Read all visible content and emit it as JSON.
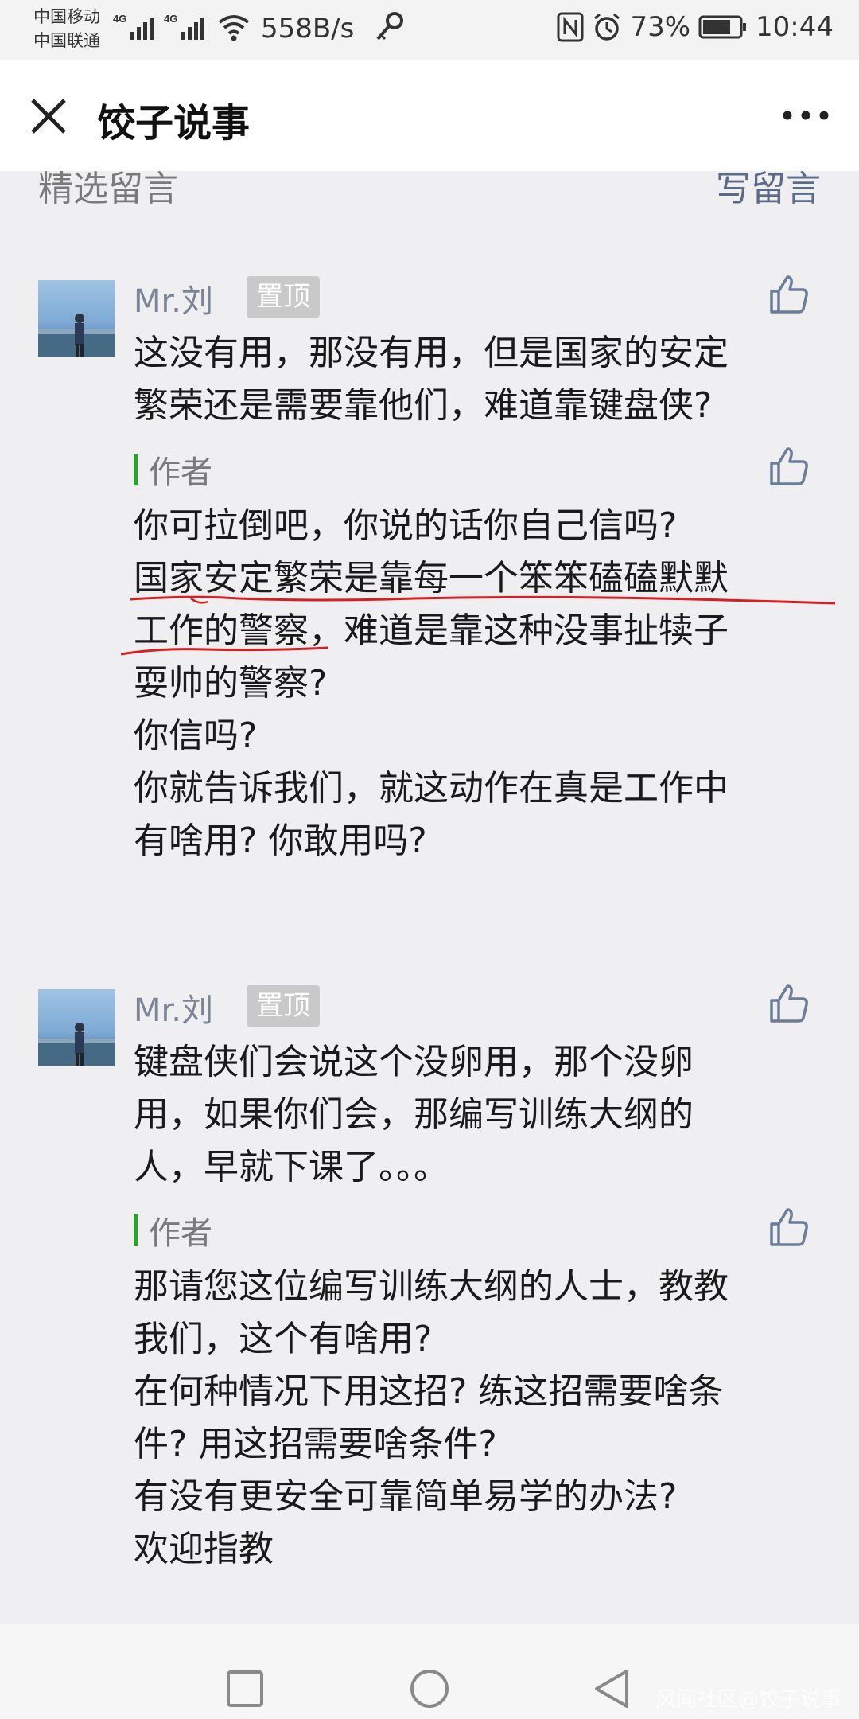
{
  "status_bar": {
    "carrier_1": "中国移动",
    "carrier_2": "中国联通",
    "net_speed": "558B/s",
    "battery": "73%",
    "time": "10:44"
  },
  "header": {
    "title": "饺子说事"
  },
  "section": {
    "title": "精选留言",
    "write_comment": "写留言"
  },
  "comments": [
    {
      "nickname": "Mr.刘",
      "badge": "置顶",
      "lines": [
        "这没有用，那没有用，但是国家的安定",
        "繁荣还是需要靠他们，难道靠键盘侠?"
      ],
      "reply": {
        "label": "作者",
        "lines": [
          "你可拉倒吧，你说的话你自己信吗?",
          "国家安定繁荣是靠每一个笨笨磕磕默默",
          "工作的警察，难道是靠这种没事扯犊子",
          "耍帅的警察?",
          "你信吗?",
          "你就告诉我们，就这动作在真是工作中",
          "有啥用? 你敢用吗?"
        ]
      }
    },
    {
      "nickname": "Mr.刘",
      "badge": "置顶",
      "lines": [
        "键盘侠们会说这个没卵用，那个没卵",
        "用，如果你们会，那编写训练大纲的",
        "人，早就下课了。。。"
      ],
      "reply": {
        "label": "作者",
        "lines": [
          "那请您这位编写训练大纲的人士，教教",
          "我们，这个有啥用?",
          "在何种情况下用这招? 练这招需要啥条",
          "件? 用这招需要啥条件?",
          "有没有更安全可靠简单易学的办法?",
          "欢迎指教"
        ]
      }
    }
  ],
  "watermark": "风闻社区@饺子说事",
  "colors": {
    "background": "#efeff1",
    "author_bar": "#29a329",
    "nickname": "#7b8596",
    "underline": "#d42020"
  }
}
